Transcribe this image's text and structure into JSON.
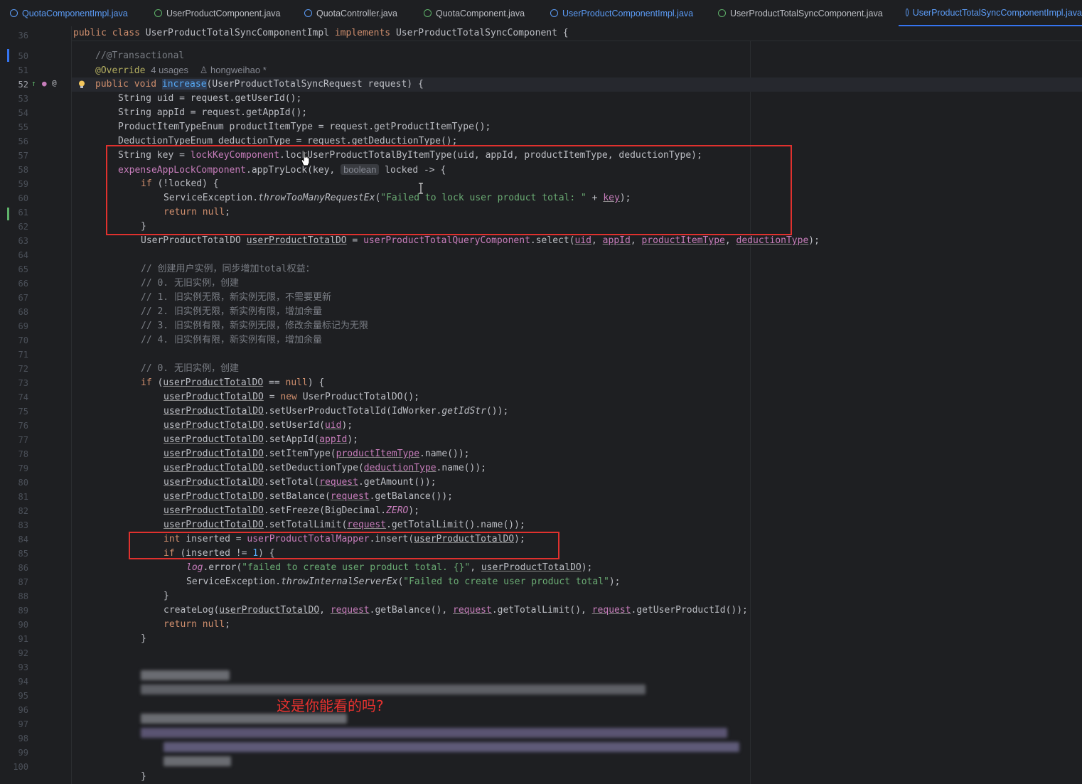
{
  "tabs": [
    {
      "label": "QuotaComponentImpl.java",
      "kind": "class",
      "active": false
    },
    {
      "label": "UserProductComponent.java",
      "kind": "interface",
      "active": false
    },
    {
      "label": "QuotaController.java",
      "kind": "class",
      "active": false
    },
    {
      "label": "QuotaComponent.java",
      "kind": "interface",
      "active": false
    },
    {
      "label": "UserProductComponentImpl.java",
      "kind": "class",
      "active": false
    },
    {
      "label": "UserProductTotalSyncComponent.java",
      "kind": "interface",
      "active": false
    },
    {
      "label": "UserProductTotalSyncComponentImpl.java",
      "kind": "class",
      "active": true
    }
  ],
  "sticky": {
    "line": "36",
    "code": "public class UserProductTotalSyncComponentImpl implements UserProductTotalSyncComponent {"
  },
  "lines": [
    {
      "n": "50",
      "code": "//@Transactional"
    },
    {
      "n": "51",
      "code": "@Override",
      "hint": "4 usages",
      "author": "hongweihao *"
    },
    {
      "n": "52",
      "code": "public void increase(UserProductTotalSyncRequest request) {"
    },
    {
      "n": "53",
      "code": "String uid = request.getUserId();"
    },
    {
      "n": "54",
      "code": "String appId = request.getAppId();"
    },
    {
      "n": "55",
      "code": "ProductItemTypeEnum productItemType = request.getProductItemType();"
    },
    {
      "n": "56",
      "code": "DeductionTypeEnum deductionType = request.getDeductionType();"
    },
    {
      "n": "57",
      "code": "String key = lockKeyComponent.lockUserProductTotalByItemType(uid, appId, productItemType, deductionType);"
    },
    {
      "n": "58",
      "code": "expenseAppLockComponent.appTryLock(key, boolean locked -> {"
    },
    {
      "n": "59",
      "code": "if (!locked) {"
    },
    {
      "n": "60",
      "code": "ServiceException.throwTooManyRequestEx(\"Failed to lock user product total: \" + key);"
    },
    {
      "n": "61",
      "code": "return null;"
    },
    {
      "n": "62",
      "code": "}"
    },
    {
      "n": "63",
      "code": "UserProductTotalDO userProductTotalDO = userProductTotalQueryComponent.select(uid, appId, productItemType, deductionType);"
    },
    {
      "n": "64",
      "code": ""
    },
    {
      "n": "65",
      "code": "// 创建用户实例，同步增加total权益："
    },
    {
      "n": "66",
      "code": "// 0. 无旧实例，创建"
    },
    {
      "n": "67",
      "code": "// 1. 旧实例无限，新实例无限，不需要更新"
    },
    {
      "n": "68",
      "code": "// 2. 旧实例无限，新实例有限，增加余量"
    },
    {
      "n": "69",
      "code": "// 3. 旧实例有限，新实例无限，修改余量标记为无限"
    },
    {
      "n": "70",
      "code": "// 4. 旧实例有限，新实例有限，增加余量"
    },
    {
      "n": "71",
      "code": ""
    },
    {
      "n": "72",
      "code": "// 0. 无旧实例，创建"
    },
    {
      "n": "73",
      "code": "if (userProductTotalDO == null) {"
    },
    {
      "n": "74",
      "code": "userProductTotalDO = new UserProductTotalDO();"
    },
    {
      "n": "75",
      "code": "userProductTotalDO.setUserProductTotalId(IdWorker.getIdStr());"
    },
    {
      "n": "76",
      "code": "userProductTotalDO.setUserId(uid);"
    },
    {
      "n": "77",
      "code": "userProductTotalDO.setAppId(appId);"
    },
    {
      "n": "78",
      "code": "userProductTotalDO.setItemType(productItemType.name());"
    },
    {
      "n": "79",
      "code": "userProductTotalDO.setDeductionType(deductionType.name());"
    },
    {
      "n": "80",
      "code": "userProductTotalDO.setTotal(request.getAmount());"
    },
    {
      "n": "81",
      "code": "userProductTotalDO.setBalance(request.getBalance());"
    },
    {
      "n": "82",
      "code": "userProductTotalDO.setFreeze(BigDecimal.ZERO);"
    },
    {
      "n": "83",
      "code": "userProductTotalDO.setTotalLimit(request.getTotalLimit().name());"
    },
    {
      "n": "84",
      "code": "int inserted = userProductTotalMapper.insert(userProductTotalDO);"
    },
    {
      "n": "85",
      "code": "if (inserted != 1) {"
    },
    {
      "n": "86",
      "code": "log.error(\"failed to create user product total. {}\", userProductTotalDO);"
    },
    {
      "n": "87",
      "code": "ServiceException.throwInternalServerEx(\"Failed to create user product total\");"
    },
    {
      "n": "88",
      "code": "}"
    },
    {
      "n": "89",
      "code": "createLog(userProductTotalDO, request.getBalance(), request.getTotalLimit(), request.getUserProductId());"
    },
    {
      "n": "90",
      "code": "return null;"
    },
    {
      "n": "91",
      "code": "}"
    },
    {
      "n": "92",
      "code": ""
    },
    {
      "n": "93",
      "code": ""
    },
    {
      "n": "94",
      "code": ""
    },
    {
      "n": "95",
      "code": ""
    },
    {
      "n": "96",
      "code": ""
    },
    {
      "n": "97",
      "code": ""
    },
    {
      "n": "98",
      "code": ""
    },
    {
      "n": "99",
      "code": ""
    },
    {
      "n": "100",
      "code": ""
    }
  ],
  "overlay_caption": "这是你能看的吗?",
  "colors": {
    "highlight_box": "#e0312e",
    "editor_bg": "#1e1f22",
    "active_tab_underline": "#3574f0"
  }
}
